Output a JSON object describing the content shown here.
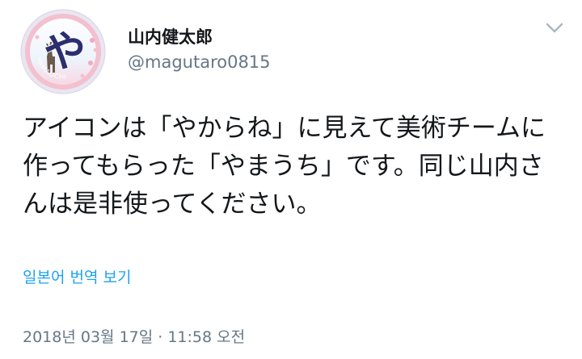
{
  "tweet": {
    "author": {
      "display_name": "山内健太郎",
      "handle": "@magutaro0815",
      "avatar": {
        "glyph": "や",
        "ring_text": "YAMAUCHI",
        "ring_color": "#f3c0cf",
        "glyph_color": "#2b2f6e"
      }
    },
    "menu_icon": "chevron-down-icon",
    "text": "アイコンは「やからね」に見えて美術チームに作ってもらった「やまうち」です。同じ山内さんは是非使ってください。",
    "translate_label": "일본어 번역 보기",
    "timestamp": "2018년 03월 17일 · 11:58 오전"
  },
  "colors": {
    "link": "#1da1f2",
    "secondary_text": "#657786",
    "primary_text": "#14171a"
  }
}
